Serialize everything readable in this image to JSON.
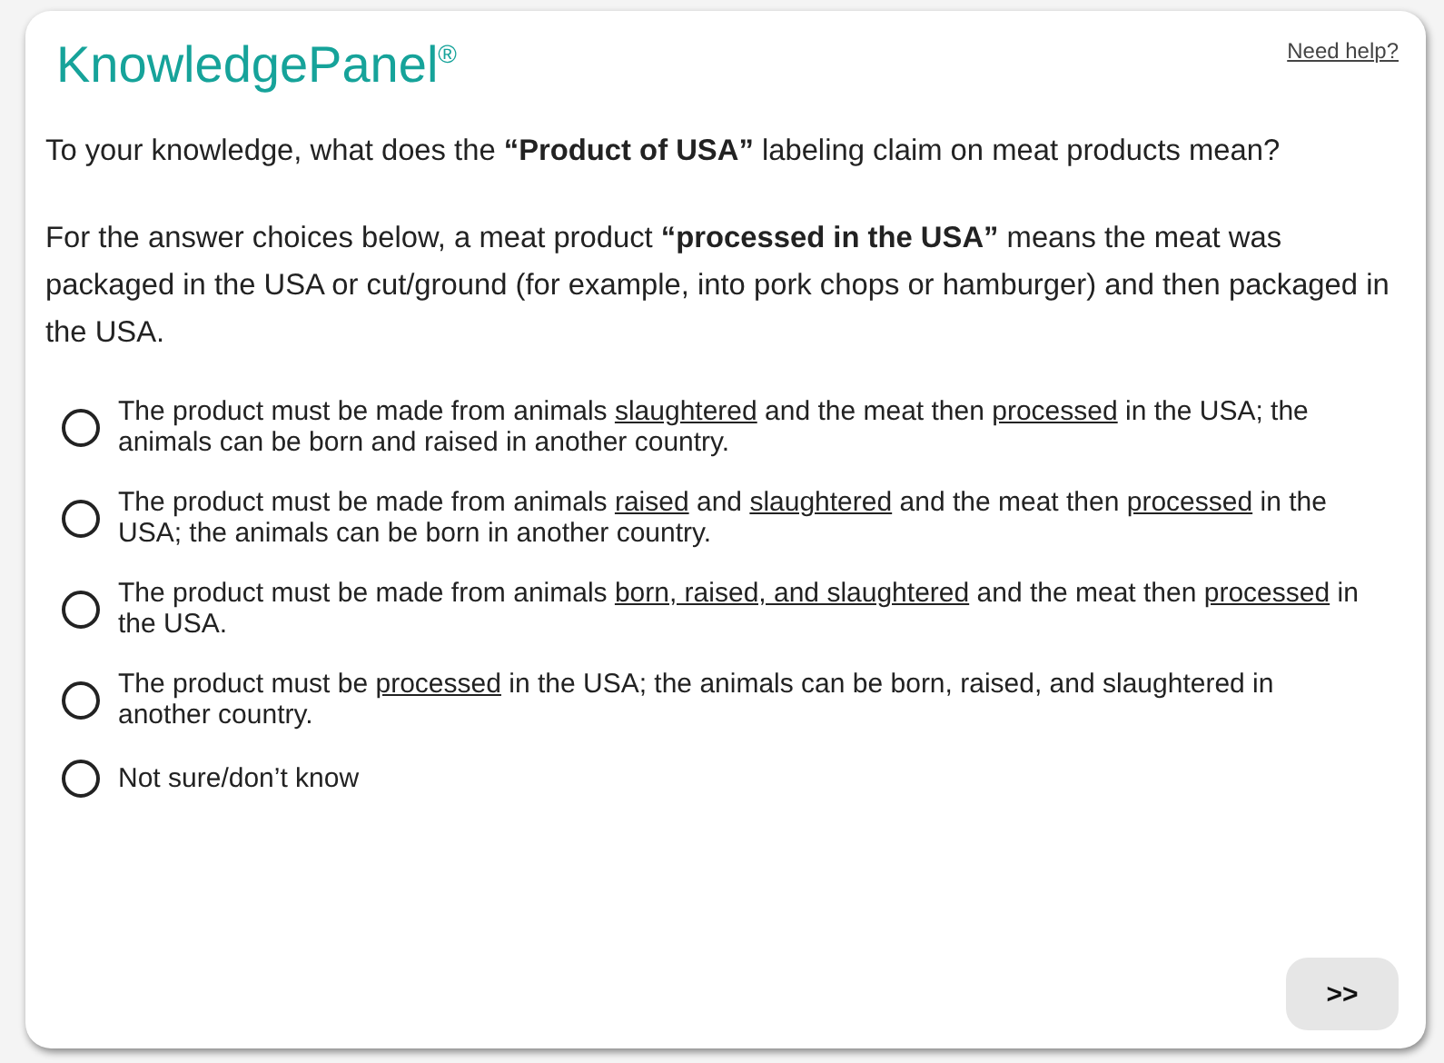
{
  "logo": "KnowledgePanel$^{®}$",
  "help_link": "Need help?",
  "question": "To your knowledge, what does the **“Product of USA”** labeling claim on meat products mean?",
  "instruction": "For the answer choices below, a meat product **“processed in the USA”** means the meat was packaged in the USA or cut/ground (for example, into pork chops or hamburger) and then packaged in the USA.",
  "options": [
    {
      "selected": false,
      "segments": [
        {
          "text": "The product must be made from animals ",
          "underline": false
        },
        {
          "text": "slaughtered",
          "underline": true
        },
        {
          "text": " and the meat then ",
          "underline": false
        },
        {
          "text": "processed",
          "underline": true
        },
        {
          "text": " in the USA; the animals can be born and raised in another country.",
          "underline": false
        }
      ]
    },
    {
      "selected": false,
      "segments": [
        {
          "text": "The product must be made from animals ",
          "underline": false
        },
        {
          "text": "raised",
          "underline": true
        },
        {
          "text": " and ",
          "underline": false
        },
        {
          "text": "slaughtered",
          "underline": true
        },
        {
          "text": " and the meat then ",
          "underline": false
        },
        {
          "text": "processed",
          "underline": true
        },
        {
          "text": " in the USA; the animals can be born in another country.",
          "underline": false
        }
      ]
    },
    {
      "selected": false,
      "segments": [
        {
          "text": "The product must be made from animals ",
          "underline": false
        },
        {
          "text": "born, raised, and slaughtered",
          "underline": true
        },
        {
          "text": " and the meat then ",
          "underline": false
        },
        {
          "text": "processed",
          "underline": true
        },
        {
          "text": " in the USA.",
          "underline": false
        }
      ]
    },
    {
      "selected": false,
      "segments": [
        {
          "text": "The product must be ",
          "underline": false
        },
        {
          "text": "processed",
          "underline": true
        },
        {
          "text": " in the USA; the animals can be born, raised, and slaughtered in another country.",
          "underline": false
        }
      ]
    },
    {
      "selected": false,
      "segments": [
        {
          "text": "Not sure/don’t know",
          "underline": false
        }
      ]
    }
  ],
  "next_button": ">>"
}
